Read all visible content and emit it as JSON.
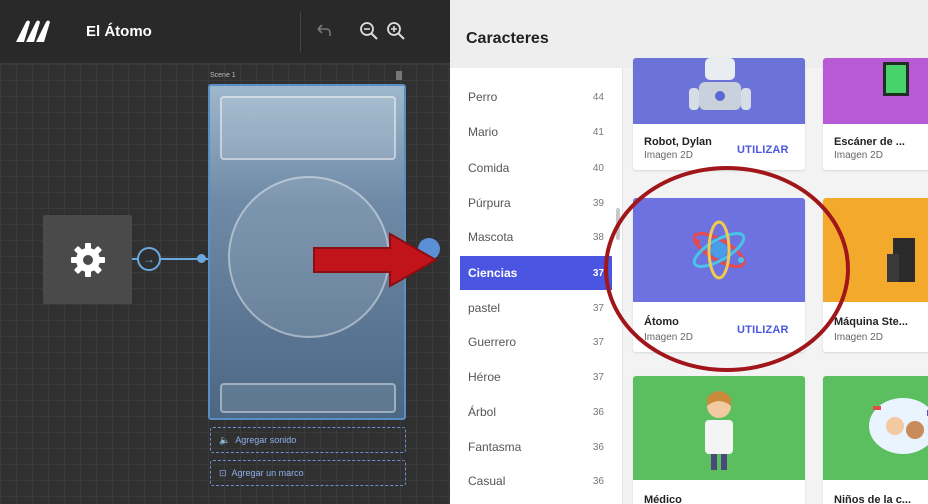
{
  "header": {
    "title": "El Átomo",
    "undo_icon": "undo-icon",
    "zoom_out_icon": "zoom-out-icon",
    "zoom_in_icon": "zoom-in-icon"
  },
  "scene": {
    "label": "Scene 1",
    "add_sound": "Agregar sonido",
    "add_frame": "Agregar un marco"
  },
  "modal": {
    "title": "Caracteres",
    "categories": [
      {
        "label": "Perro",
        "count": "44"
      },
      {
        "label": "Mario",
        "count": "41"
      },
      {
        "label": "Comida",
        "count": "40"
      },
      {
        "label": "Púrpura",
        "count": "39"
      },
      {
        "label": "Mascota",
        "count": "38"
      },
      {
        "label": "Ciencias",
        "count": "37"
      },
      {
        "label": "pastel",
        "count": "37"
      },
      {
        "label": "Guerrero",
        "count": "37"
      },
      {
        "label": "Héroe",
        "count": "37"
      },
      {
        "label": "Árbol",
        "count": "36"
      },
      {
        "label": "Fantasma",
        "count": "36"
      },
      {
        "label": "Casual",
        "count": "36"
      }
    ],
    "active_category": "Ciencias",
    "cards": [
      {
        "name": "Robot, Dylan",
        "type": "Imagen 2D",
        "action": "UTILIZAR"
      },
      {
        "name": "Escáner de ...",
        "type": "Imagen 2D",
        "action": ""
      },
      {
        "name": "Átomo",
        "type": "Imagen 2D",
        "action": "UTILIZAR"
      },
      {
        "name": "Máquina Ste...",
        "type": "Imagen 2D",
        "action": ""
      },
      {
        "name": "Médico",
        "type": "",
        "action": ""
      },
      {
        "name": "Niños de la c...",
        "type": "",
        "action": ""
      }
    ]
  },
  "colors": {
    "accent": "#4a56e2",
    "annotation_red": "#b01c1c",
    "editor_bg": "#2e2e2e"
  }
}
